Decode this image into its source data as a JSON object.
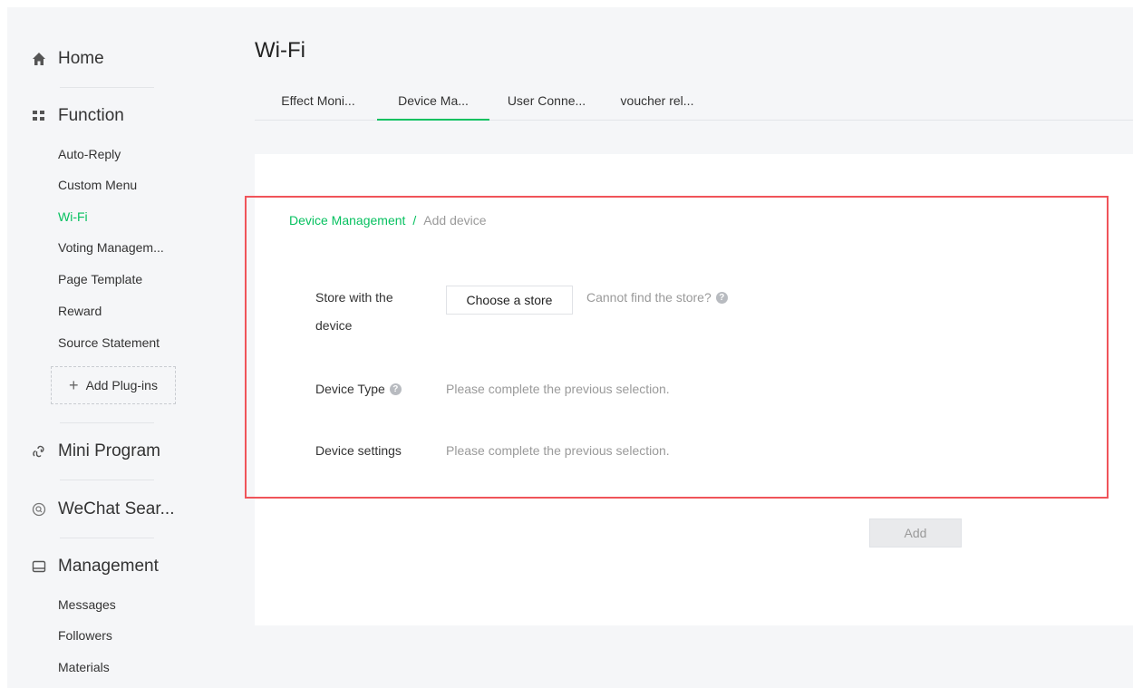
{
  "sidebar": {
    "home": {
      "label": "Home",
      "icon": "home-icon"
    },
    "function": {
      "label": "Function",
      "icon": "grid-icon",
      "items": [
        "Auto-Reply",
        "Custom Menu",
        "Wi-Fi",
        "Voting Managem...",
        "Page Template",
        "Reward",
        "Source Statement"
      ],
      "active": "Wi-Fi"
    },
    "add_plugins": "Add Plug-ins",
    "mini_program": {
      "label": "Mini Program",
      "icon": "link-icon"
    },
    "wechat_search": {
      "label": "WeChat Sear...",
      "icon": "search-circle-icon"
    },
    "management": {
      "label": "Management",
      "icon": "inbox-icon",
      "items": [
        "Messages",
        "Followers",
        "Materials"
      ]
    }
  },
  "page_title": "Wi-Fi",
  "tabs": [
    {
      "label": "Effect Moni...",
      "active": false
    },
    {
      "label": "Device Ma...",
      "active": true
    },
    {
      "label": "User Conne...",
      "active": false
    },
    {
      "label": "voucher rel...",
      "active": false
    }
  ],
  "breadcrumb": {
    "parent": "Device Management",
    "separator": "/",
    "current": "Add device"
  },
  "form": {
    "store_label": "Store with the device",
    "store_label_line1": "Store with the",
    "store_label_line2": "device",
    "choose_store_button": "Choose a store",
    "store_help": "Cannot find the store?",
    "device_type_label": "Device Type",
    "device_type_hint": "Please complete the previous selection.",
    "device_settings_label": "Device settings",
    "device_settings_hint": "Please complete the previous selection."
  },
  "add_button": "Add",
  "colors": {
    "accent": "#07c160",
    "highlight_border": "#f0545a",
    "background": "#f5f6f8"
  }
}
